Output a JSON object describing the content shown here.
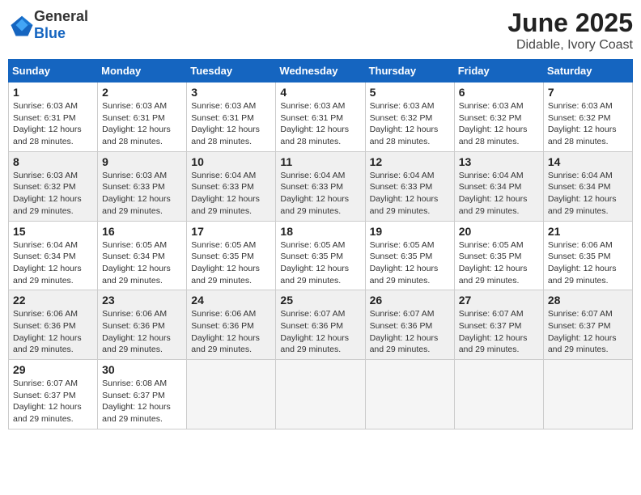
{
  "logo": {
    "general": "General",
    "blue": "Blue"
  },
  "title": "June 2025",
  "location": "Didable, Ivory Coast",
  "weekdays": [
    "Sunday",
    "Monday",
    "Tuesday",
    "Wednesday",
    "Thursday",
    "Friday",
    "Saturday"
  ],
  "weeks": [
    [
      {
        "day": "1",
        "sunrise": "6:03 AM",
        "sunset": "6:31 PM",
        "daylight": "12 hours and 28 minutes."
      },
      {
        "day": "2",
        "sunrise": "6:03 AM",
        "sunset": "6:31 PM",
        "daylight": "12 hours and 28 minutes."
      },
      {
        "day": "3",
        "sunrise": "6:03 AM",
        "sunset": "6:31 PM",
        "daylight": "12 hours and 28 minutes."
      },
      {
        "day": "4",
        "sunrise": "6:03 AM",
        "sunset": "6:31 PM",
        "daylight": "12 hours and 28 minutes."
      },
      {
        "day": "5",
        "sunrise": "6:03 AM",
        "sunset": "6:32 PM",
        "daylight": "12 hours and 28 minutes."
      },
      {
        "day": "6",
        "sunrise": "6:03 AM",
        "sunset": "6:32 PM",
        "daylight": "12 hours and 28 minutes."
      },
      {
        "day": "7",
        "sunrise": "6:03 AM",
        "sunset": "6:32 PM",
        "daylight": "12 hours and 28 minutes."
      }
    ],
    [
      {
        "day": "8",
        "sunrise": "6:03 AM",
        "sunset": "6:32 PM",
        "daylight": "12 hours and 29 minutes."
      },
      {
        "day": "9",
        "sunrise": "6:03 AM",
        "sunset": "6:33 PM",
        "daylight": "12 hours and 29 minutes."
      },
      {
        "day": "10",
        "sunrise": "6:04 AM",
        "sunset": "6:33 PM",
        "daylight": "12 hours and 29 minutes."
      },
      {
        "day": "11",
        "sunrise": "6:04 AM",
        "sunset": "6:33 PM",
        "daylight": "12 hours and 29 minutes."
      },
      {
        "day": "12",
        "sunrise": "6:04 AM",
        "sunset": "6:33 PM",
        "daylight": "12 hours and 29 minutes."
      },
      {
        "day": "13",
        "sunrise": "6:04 AM",
        "sunset": "6:34 PM",
        "daylight": "12 hours and 29 minutes."
      },
      {
        "day": "14",
        "sunrise": "6:04 AM",
        "sunset": "6:34 PM",
        "daylight": "12 hours and 29 minutes."
      }
    ],
    [
      {
        "day": "15",
        "sunrise": "6:04 AM",
        "sunset": "6:34 PM",
        "daylight": "12 hours and 29 minutes."
      },
      {
        "day": "16",
        "sunrise": "6:05 AM",
        "sunset": "6:34 PM",
        "daylight": "12 hours and 29 minutes."
      },
      {
        "day": "17",
        "sunrise": "6:05 AM",
        "sunset": "6:35 PM",
        "daylight": "12 hours and 29 minutes."
      },
      {
        "day": "18",
        "sunrise": "6:05 AM",
        "sunset": "6:35 PM",
        "daylight": "12 hours and 29 minutes."
      },
      {
        "day": "19",
        "sunrise": "6:05 AM",
        "sunset": "6:35 PM",
        "daylight": "12 hours and 29 minutes."
      },
      {
        "day": "20",
        "sunrise": "6:05 AM",
        "sunset": "6:35 PM",
        "daylight": "12 hours and 29 minutes."
      },
      {
        "day": "21",
        "sunrise": "6:06 AM",
        "sunset": "6:35 PM",
        "daylight": "12 hours and 29 minutes."
      }
    ],
    [
      {
        "day": "22",
        "sunrise": "6:06 AM",
        "sunset": "6:36 PM",
        "daylight": "12 hours and 29 minutes."
      },
      {
        "day": "23",
        "sunrise": "6:06 AM",
        "sunset": "6:36 PM",
        "daylight": "12 hours and 29 minutes."
      },
      {
        "day": "24",
        "sunrise": "6:06 AM",
        "sunset": "6:36 PM",
        "daylight": "12 hours and 29 minutes."
      },
      {
        "day": "25",
        "sunrise": "6:07 AM",
        "sunset": "6:36 PM",
        "daylight": "12 hours and 29 minutes."
      },
      {
        "day": "26",
        "sunrise": "6:07 AM",
        "sunset": "6:36 PM",
        "daylight": "12 hours and 29 minutes."
      },
      {
        "day": "27",
        "sunrise": "6:07 AM",
        "sunset": "6:37 PM",
        "daylight": "12 hours and 29 minutes."
      },
      {
        "day": "28",
        "sunrise": "6:07 AM",
        "sunset": "6:37 PM",
        "daylight": "12 hours and 29 minutes."
      }
    ],
    [
      {
        "day": "29",
        "sunrise": "6:07 AM",
        "sunset": "6:37 PM",
        "daylight": "12 hours and 29 minutes."
      },
      {
        "day": "30",
        "sunrise": "6:08 AM",
        "sunset": "6:37 PM",
        "daylight": "12 hours and 29 minutes."
      },
      null,
      null,
      null,
      null,
      null
    ]
  ],
  "labels": {
    "sunrise": "Sunrise:",
    "sunset": "Sunset:",
    "daylight": "Daylight:"
  }
}
